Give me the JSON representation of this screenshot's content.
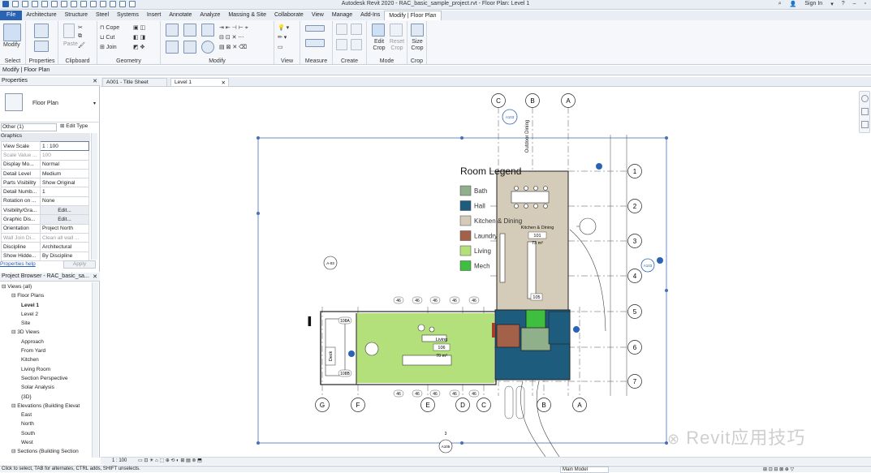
{
  "title_bar": {
    "title": "Autodesk Revit 2020 - RAC_basic_sample_project.rvt - Floor Plan: Level 1",
    "sign_in": "Sign In"
  },
  "ribbon_tabs": [
    "File",
    "Architecture",
    "Structure",
    "Steel",
    "Systems",
    "Insert",
    "Annotate",
    "Analyze",
    "Massing & Site",
    "Collaborate",
    "View",
    "Manage",
    "Add-Ins",
    "Modify | Floor Plan"
  ],
  "active_tab": "Modify | Floor Plan",
  "ribbon": {
    "select_label": "Select",
    "modify_label": "Modify",
    "properties_label": "Properties",
    "clipboard_label": "Clipboard",
    "paste_label": "Paste",
    "cope_label": "Cope",
    "cut_label": "Cut",
    "join_label": "Join",
    "geometry_label": "Geometry",
    "modify_group_label": "Modify",
    "view_label": "View",
    "measure_label": "Measure",
    "create_label": "Create",
    "edit_crop_label": "Edit Crop",
    "reset_crop_label": "Reset Crop",
    "size_crop_label": "Size Crop",
    "mode_label": "Mode",
    "crop_label": "Crop"
  },
  "context_bar": "Modify | Floor Plan",
  "properties": {
    "header": "Properties",
    "type_name": "Floor Plan",
    "filter": "Other (1)",
    "edit_type": "Edit Type",
    "section": "Graphics",
    "rows": [
      {
        "k": "View Scale",
        "v": "1 : 100"
      },
      {
        "k": "Scale Value ...",
        "v": "100"
      },
      {
        "k": "Display Mo...",
        "v": "Normal"
      },
      {
        "k": "Detail Level",
        "v": "Medium"
      },
      {
        "k": "Parts Visibility",
        "v": "Show Original"
      },
      {
        "k": "Detail Numb...",
        "v": "1"
      },
      {
        "k": "Rotation on ...",
        "v": "None"
      },
      {
        "k": "Visibility/Gra...",
        "v": "Edit..."
      },
      {
        "k": "Graphic Dis...",
        "v": "Edit..."
      },
      {
        "k": "Orientation",
        "v": "Project North"
      },
      {
        "k": "Wall Join Di...",
        "v": "Clean all wall ..."
      },
      {
        "k": "Discipline",
        "v": "Architectural"
      },
      {
        "k": "Show Hidde...",
        "v": "By Discipline"
      }
    ],
    "help": "Properties help",
    "apply": "Apply"
  },
  "browser": {
    "header": "Project Browser - RAC_basic_sa...",
    "items": [
      {
        "label": "Views (all)",
        "indent": 0
      },
      {
        "label": "Floor Plans",
        "indent": 1
      },
      {
        "label": "Level 1",
        "indent": 2,
        "bold": true
      },
      {
        "label": "Level 2",
        "indent": 2
      },
      {
        "label": "Site",
        "indent": 2
      },
      {
        "label": "3D Views",
        "indent": 1
      },
      {
        "label": "Approach",
        "indent": 2
      },
      {
        "label": "From Yard",
        "indent": 2
      },
      {
        "label": "Kitchen",
        "indent": 2
      },
      {
        "label": "Living Room",
        "indent": 2
      },
      {
        "label": "Section Perspective",
        "indent": 2
      },
      {
        "label": "Solar Analysis",
        "indent": 2
      },
      {
        "label": "{3D}",
        "indent": 2
      },
      {
        "label": "Elevations (Building Elevat",
        "indent": 1
      },
      {
        "label": "East",
        "indent": 2
      },
      {
        "label": "North",
        "indent": 2
      },
      {
        "label": "South",
        "indent": 2
      },
      {
        "label": "West",
        "indent": 2
      },
      {
        "label": "Sections (Building Section",
        "indent": 1
      }
    ]
  },
  "view_tabs": [
    {
      "label": "A001 - Title Sheet",
      "active": false
    },
    {
      "label": "Level 1",
      "active": true
    }
  ],
  "legend": {
    "title": "Room Legend",
    "items": [
      {
        "label": "Bath",
        "color": "#8fb08a"
      },
      {
        "label": "Hall",
        "color": "#1e5c7e"
      },
      {
        "label": "Kitchen & Dining",
        "color": "#d4cbb8"
      },
      {
        "label": "Laundry",
        "color": "#a4614a"
      },
      {
        "label": "Living",
        "color": "#b4e07c"
      },
      {
        "label": "Mech",
        "color": "#3fbf3f"
      }
    ]
  },
  "grids_top": [
    "C",
    "B",
    "A"
  ],
  "grids_bottom": [
    "G",
    "F",
    "E",
    "D",
    "C",
    "B",
    "A"
  ],
  "grids_right": [
    "1",
    "2",
    "3",
    "4",
    "5",
    "6",
    "7"
  ],
  "room_tags": {
    "kitchen": {
      "name": "Kitchen & Dining",
      "number": "101",
      "area": "73 m²"
    },
    "living": {
      "name": "Living",
      "number": "106",
      "area": "70 m²"
    },
    "mech_number": "105"
  },
  "labels": {
    "outdoor_dining": "Outdoor Dining",
    "deck": "Deck",
    "elev_a103": "A103",
    "elev_a105": "A105",
    "a103_b": "A-03",
    "sec_3": "3",
    "dim_46": "46",
    "room_108a": "108A",
    "room_108b": "108B"
  },
  "view_control": {
    "scale": "1 : 100"
  },
  "status": {
    "hint": "Click to select, TAB for alternates, CTRL adds, SHIFT unselects.",
    "model": "Main Model"
  },
  "watermark": "Revit应用技巧"
}
